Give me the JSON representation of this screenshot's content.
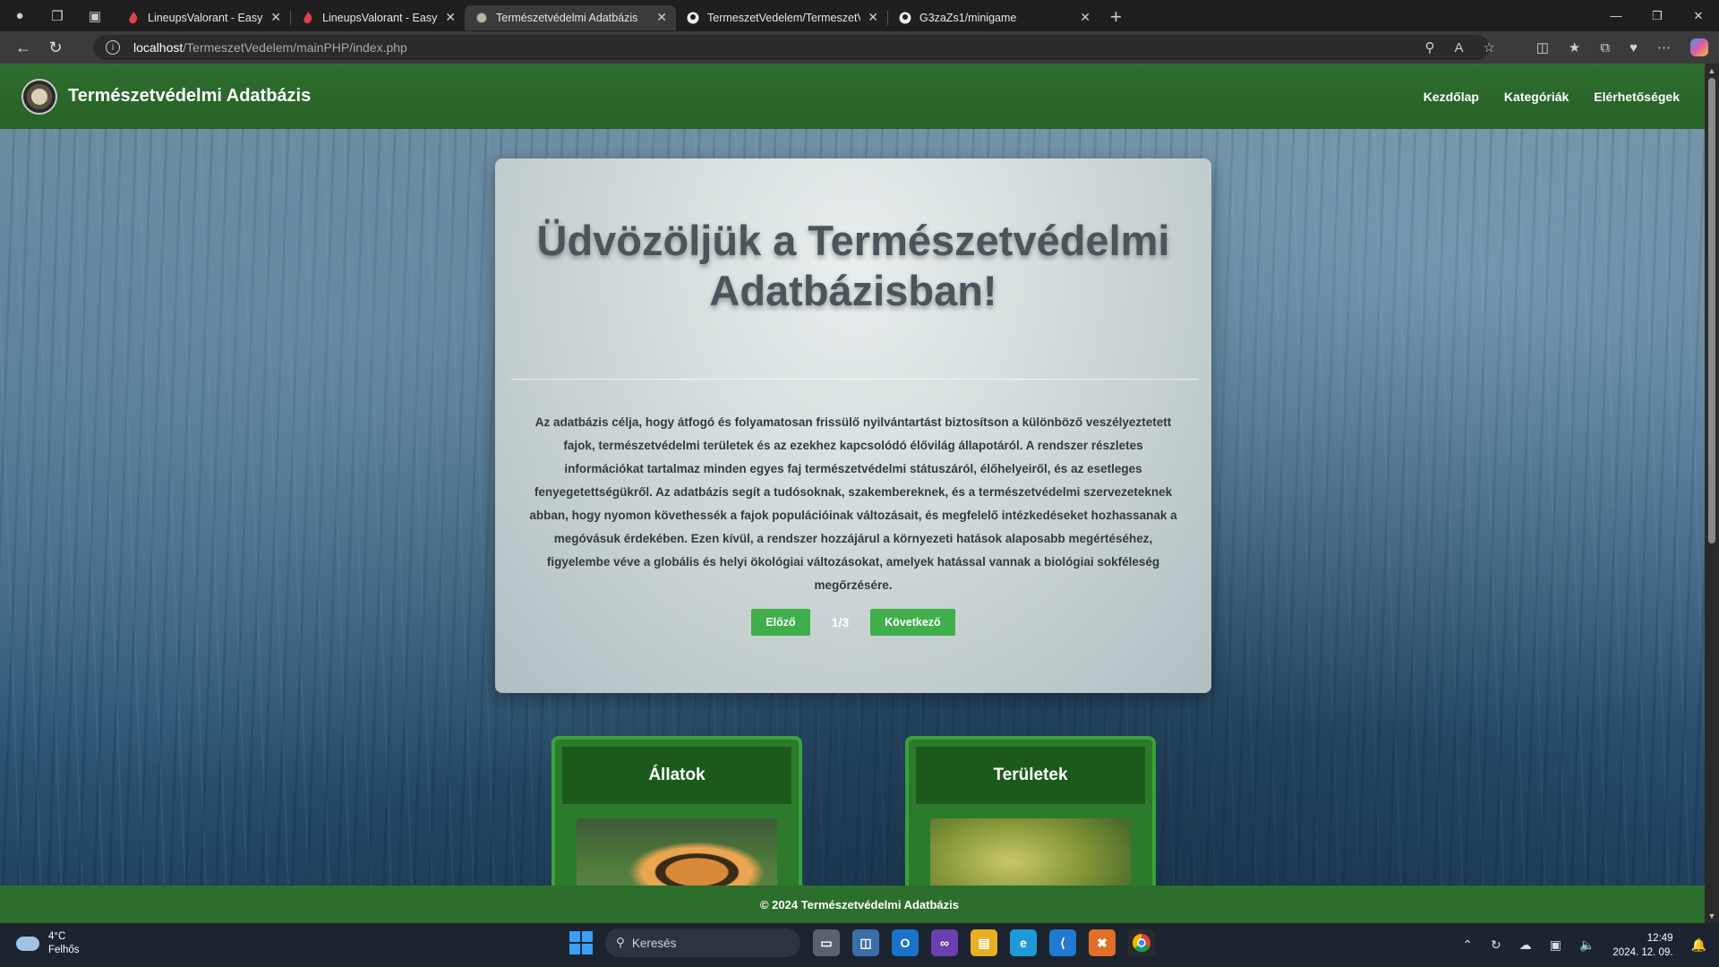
{
  "browser": {
    "tabs": [
      {
        "title": "LineupsValorant - Easy Valorant L",
        "favicon": "valorant-icon",
        "active": false
      },
      {
        "title": "LineupsValorant - Easy Valorant L",
        "favicon": "valorant-icon",
        "active": false
      },
      {
        "title": "Természetvédelmi Adatbázis",
        "favicon": "site-icon",
        "active": true
      },
      {
        "title": "TermeszetVedelem/TermeszetVed",
        "favicon": "github-icon",
        "active": false
      },
      {
        "title": "G3zaZs1/minigame",
        "favicon": "github-icon",
        "active": false
      }
    ],
    "url_host": "localhost",
    "url_path": "/TermeszetVedelem/mainPHP/index.php"
  },
  "site": {
    "brand": "Természetvédelmi Adatbázis",
    "nav": [
      "Kezdőlap",
      "Kategóriák",
      "Elérhetőségek"
    ],
    "hero": {
      "title": "Üdvözöljük a Természetvédelmi Adatbázisban!",
      "text": "Az adatbázis célja, hogy átfogó és folyamatosan frissülő nyilvántartást biztosítson a különböző veszélyeztetett fajok, természetvédelmi területek és az ezekhez kapcsolódó élővilág állapotáról. A rendszer részletes információkat tartalmaz minden egyes faj természetvédelmi státuszáról, élőhelyeiről, és az esetleges fenyegetettségükről. Az adatbázis segít a tudósoknak, szakembereknek, és a természetvédelmi szervezeteknek abban, hogy nyomon követhessék a fajok populációinak változásait, és megfelelő intézkedéseket hozhassanak a megóvásuk érdekében. Ezen kívül, a rendszer hozzájárul a környezeti hatások alaposabb megértéséhez, figyelembe véve a globális és helyi ökológiai változásokat, amelyek hatással vannak a biológiai sokféleség megőrzésére.",
      "prev": "Előző",
      "page": "1/3",
      "next": "Következő"
    },
    "cards": [
      {
        "title": "Állatok",
        "image": "tiger-photo"
      },
      {
        "title": "Területek",
        "image": "nature-area-photo"
      }
    ],
    "footer": "© 2024 Természetvédelmi Adatbázis"
  },
  "taskbar": {
    "weather_temp": "4°C",
    "weather_desc": "Felhős",
    "search_placeholder": "Keresés",
    "time": "12:49",
    "date": "2024. 12. 09."
  }
}
